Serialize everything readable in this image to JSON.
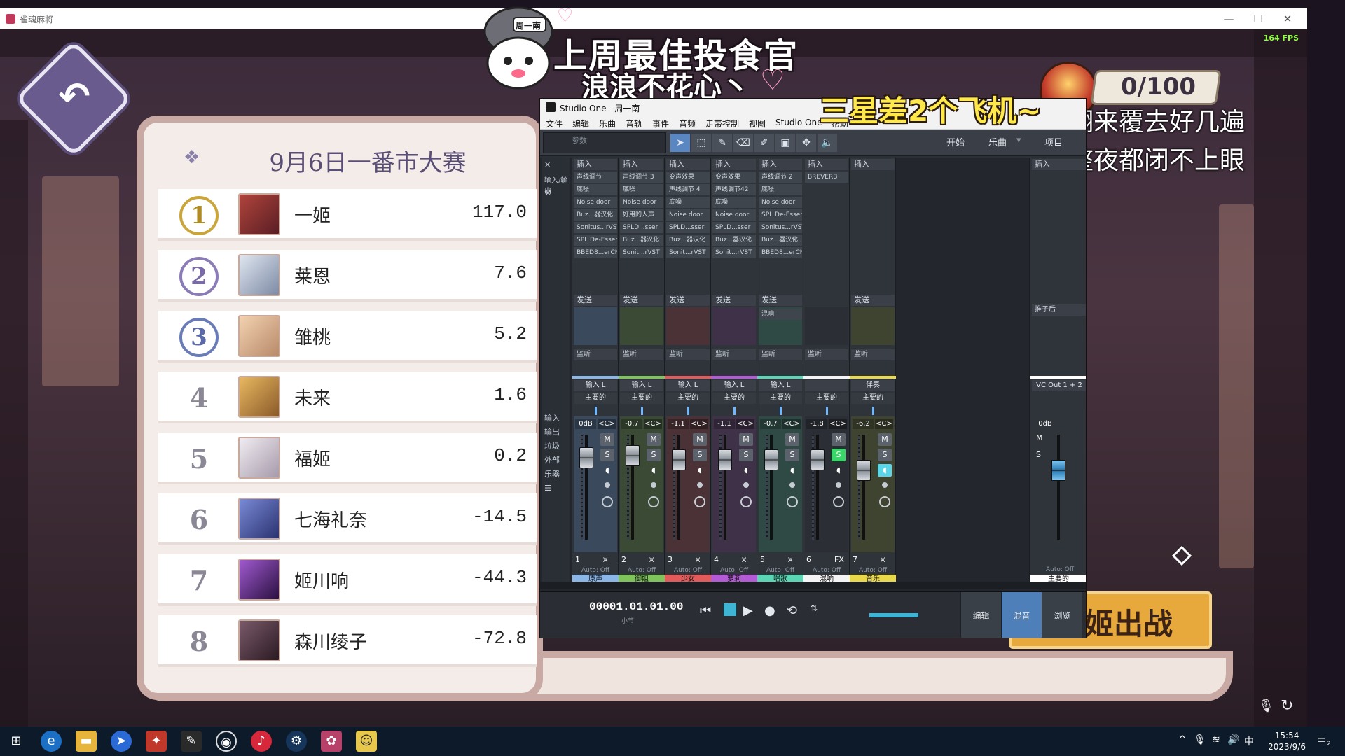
{
  "game": {
    "window_title": "雀魂麻将",
    "fps": "164 FPS",
    "panel_title": "9月6日一番市大赛",
    "start_button": "姬出战",
    "ranking": [
      {
        "rank": "1",
        "name": "一姬",
        "score": "117.0",
        "avatar_color": "#b0443c"
      },
      {
        "rank": "2",
        "name": "莱恩",
        "score": "7.6",
        "avatar_color": "#aeb9cc"
      },
      {
        "rank": "3",
        "name": "雏桃",
        "score": "5.2",
        "avatar_color": "#e3b58c"
      },
      {
        "rank": "4",
        "name": "未来",
        "score": "1.6",
        "avatar_color": "#c88d3c"
      },
      {
        "rank": "5",
        "name": "福姬",
        "score": "0.2",
        "avatar_color": "#d8d0dc"
      },
      {
        "rank": "6",
        "name": "七海礼奈",
        "score": "-14.5",
        "avatar_color": "#4a5ca8"
      },
      {
        "rank": "7",
        "name": "姬川响",
        "score": "-44.3",
        "avatar_color": "#6a2e8a"
      },
      {
        "rank": "8",
        "name": "森川绫子",
        "score": "-72.8",
        "avatar_color": "#4a3440"
      }
    ]
  },
  "overlay": {
    "title": "上周最佳投食官",
    "subtitle": "浪浪不花心丶",
    "star_text": "三星差2个飞机~",
    "counter": "0/100",
    "lyric1": "翻来覆去好几遍",
    "lyric2": "整夜都闭不上眼",
    "mascot_tag": "周一南"
  },
  "studio_one": {
    "window_title": "Studio One - 周一南",
    "menu": [
      "文件",
      "编辑",
      "乐曲",
      "音轨",
      "事件",
      "音频",
      "走带控制",
      "视图",
      "Studio One",
      "帮助"
    ],
    "params_label": "参数",
    "nav": [
      "开始",
      "乐曲",
      "项目"
    ],
    "sidebar": [
      "输入/输出",
      "输入",
      "输出",
      "垃圾",
      "外部",
      "乐器"
    ],
    "insert_label": "插入",
    "send_label": "发送",
    "monitor_label": "监听",
    "channels": [
      {
        "num": "1",
        "input": "输入 L",
        "output": "主要的",
        "vol": "0dB",
        "pan": "<C>",
        "name": "原声",
        "color": "#8ab6e8",
        "bg": "#3a4a5c",
        "plugins": [
          "声线调节",
          "底噪",
          "Noise door",
          "Buz...器汉化",
          "Sonitus...rVST",
          "SPL De-Esser",
          "BBED8...erCN"
        ]
      },
      {
        "num": "2",
        "input": "输入 L",
        "output": "主要的",
        "vol": "-0.7",
        "pan": "<C>",
        "name": "御姐",
        "color": "#7ec45a",
        "bg": "#3a4a35",
        "plugins": [
          "声线调节 3",
          "底噪",
          "Noise door",
          "好用的人声",
          "SPLD...sser",
          "Buz...器汉化",
          "Sonit...rVST"
        ]
      },
      {
        "num": "3",
        "input": "输入 L",
        "output": "主要的",
        "vol": "-1.1",
        "pan": "<C>",
        "name": "少女",
        "color": "#e35a5a",
        "bg": "#4a3236",
        "plugins": [
          "变声效果",
          "声线调节 4",
          "底噪",
          "Noise door",
          "SPLD...sser",
          "Buz...器汉化",
          "Sonit...rVST"
        ]
      },
      {
        "num": "4",
        "input": "输入 L",
        "output": "主要的",
        "vol": "-1.1",
        "pan": "<C>",
        "name": "萝莉",
        "color": "#b45ad6",
        "bg": "#3f3248",
        "plugins": [
          "变声效果",
          "声线调节42",
          "底噪",
          "Noise door",
          "SPLD...sser",
          "Buz...器汉化",
          "Sonit...rVST"
        ]
      },
      {
        "num": "5",
        "input": "输入 L",
        "output": "主要的",
        "vol": "-0.7",
        "pan": "<C>",
        "name": "唱歌",
        "color": "#5ad6b4",
        "bg": "#2f4a44",
        "plugins": [
          "声线调节 2",
          "底噪",
          "Noise door",
          "SPL De-Esser",
          "Sonitus...rVST",
          "Buz...器汉化",
          "BBED8...erCN"
        ]
      },
      {
        "num": "6",
        "input": "",
        "output": "主要的",
        "vol": "-1.8",
        "pan": "<C>",
        "name": "混响",
        "color": "#f4f4f4",
        "bg": "#2b2f35",
        "plugins": [
          "BREVERB"
        ],
        "fx": "FX"
      },
      {
        "num": "7",
        "input": "伴奏",
        "output": "主要的",
        "vol": "-6.2",
        "pan": "<C>",
        "name": "音乐",
        "color": "#e8d84a",
        "bg": "#3f4430",
        "plugins": []
      }
    ],
    "send_item": "混响",
    "master": {
      "output": "VC Out 1 + 2",
      "vol": "0dB",
      "name": "主要的",
      "post_label": "推子后"
    },
    "auto_label": "Auto: Off",
    "timecode": "00001.01.01.00",
    "timecode_unit": "小节",
    "views": [
      "编辑",
      "混音",
      "浏览"
    ]
  },
  "taskbar": {
    "time": "15:54",
    "date": "2023/9/6",
    "ime": "中",
    "notifications": "2"
  }
}
